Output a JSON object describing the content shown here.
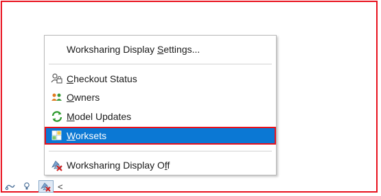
{
  "colors": {
    "highlight_border": "#e8101c",
    "selected_bg": "#0b78d4",
    "menu_border": "#b7b7b7"
  },
  "menu": {
    "items": [
      {
        "label_pre": "Worksharing Display ",
        "label_ul": "S",
        "label_post": "ettings...",
        "icon": null
      },
      {
        "label_pre": "",
        "label_ul": "C",
        "label_post": "heckout Status",
        "icon": "checkout-status-icon"
      },
      {
        "label_pre": "",
        "label_ul": "O",
        "label_post": "wners",
        "icon": "owners-icon"
      },
      {
        "label_pre": "",
        "label_ul": "M",
        "label_post": "odel Updates",
        "icon": "model-updates-icon"
      },
      {
        "label_pre": "",
        "label_ul": "W",
        "label_post": "orksets",
        "icon": "worksets-icon",
        "selected": true
      },
      {
        "label_pre": "Worksharing Display O",
        "label_ul": "f",
        "label_post": "f",
        "icon": "worksharing-display-off-icon"
      }
    ]
  },
  "statusbar": {
    "icons": [
      "link-icon",
      "bulb-icon",
      "worksharing-display-icon"
    ],
    "chevron": "<"
  }
}
